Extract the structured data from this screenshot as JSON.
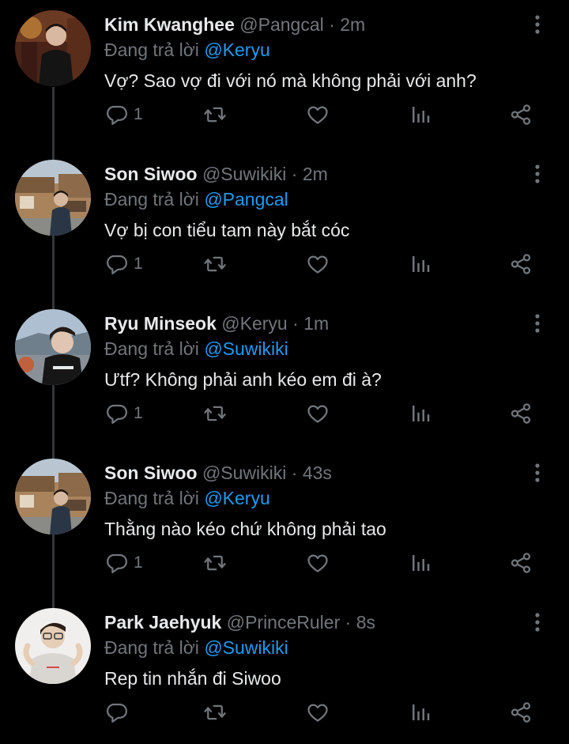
{
  "thread": {
    "tweets": [
      {
        "name": "Kim Kwanghee",
        "handle": "@Pangcal",
        "separator": "·",
        "time": "2m",
        "reply_prefix": "Đang trả lời",
        "reply_to": "@Keryu",
        "text": "Vợ? Sao vợ đi với nó mà không phải với anh?",
        "reply_count": "1"
      },
      {
        "name": "Son Siwoo",
        "handle": "@Suwikiki",
        "separator": "·",
        "time": "2m",
        "reply_prefix": "Đang trả lời",
        "reply_to": "@Pangcal",
        "text": "Vợ bị con tiểu tam này bắt cóc",
        "reply_count": "1"
      },
      {
        "name": "Ryu Minseok",
        "handle": "@Keryu",
        "separator": "·",
        "time": "1m",
        "reply_prefix": "Đang trả lời",
        "reply_to": "@Suwikiki",
        "text": "Ưtf? Không phải anh kéo em đi à?",
        "reply_count": "1"
      },
      {
        "name": "Son Siwoo",
        "handle": "@Suwikiki",
        "separator": "·",
        "time": "43s",
        "reply_prefix": "Đang trả lời",
        "reply_to": "@Keryu",
        "text": "Thằng nào kéo chứ không phải tao",
        "reply_count": "1"
      },
      {
        "name": "Park Jaehyuk",
        "handle": "@PrinceRuler",
        "separator": "·",
        "time": "8s",
        "reply_prefix": "Đang trả lời",
        "reply_to": "@Suwikiki",
        "text": "Rep tin nhắn đi Siwoo",
        "reply_count": ""
      }
    ]
  },
  "colors": {
    "background": "#000000",
    "text": "#e7e9ea",
    "muted": "#71767b",
    "mention": "#1d9bf0",
    "thread_line": "#333639"
  },
  "icons": [
    "reply-icon",
    "retweet-icon",
    "like-icon",
    "views-icon",
    "share-icon",
    "more-options-icon"
  ]
}
